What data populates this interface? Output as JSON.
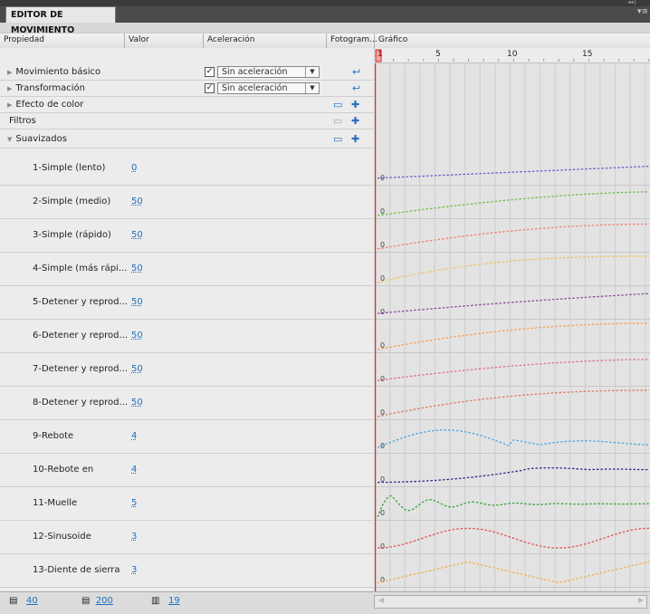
{
  "panel": {
    "tab_label": "EDITOR DE MOVIMIENTO"
  },
  "columns": {
    "property": "Propiedad",
    "value": "Valor",
    "ease": "Aceleración",
    "keyframe": "Fotogram...",
    "graph": "Gráfico"
  },
  "ruler": {
    "ticks": [
      "1",
      "5",
      "10",
      "15"
    ]
  },
  "sections": [
    {
      "label": "Movimiento básico",
      "ease_checked": true,
      "ease": "Sin aceleración"
    },
    {
      "label": "Transformación",
      "ease_checked": true,
      "ease": "Sin aceleración"
    },
    {
      "label": "Efecto de color"
    },
    {
      "label": "Filtros"
    },
    {
      "label": "Suavizados"
    }
  ],
  "eases": [
    {
      "label": "1-Simple (lento)",
      "value": "0",
      "color": "#6a5acd"
    },
    {
      "label": "2-Simple (medio)",
      "value": "50",
      "color": "#6abf4a"
    },
    {
      "label": "3-Simple (rápido)",
      "value": "50",
      "color": "#f08070"
    },
    {
      "label": "4-Simple (más rápi...",
      "value": "50",
      "color": "#f5c060"
    },
    {
      "label": "5-Detener y reprod...",
      "value": "50",
      "color": "#8a4a9a"
    },
    {
      "label": "6-Detener y reprod...",
      "value": "50",
      "color": "#f5a050"
    },
    {
      "label": "7-Detener y reprod...",
      "value": "50",
      "color": "#e0708a"
    },
    {
      "label": "8-Detener y reprod...",
      "value": "50",
      "color": "#e07a5a"
    },
    {
      "label": "9-Rebote",
      "value": "4",
      "color": "#4aa8e0"
    },
    {
      "label": "10-Rebote en",
      "value": "4",
      "color": "#2a2a8a"
    },
    {
      "label": "11-Muelle",
      "value": "5",
      "color": "#3aa03a"
    },
    {
      "label": "12-Sinusoide",
      "value": "3",
      "color": "#e05050"
    },
    {
      "label": "13-Diente de sierra",
      "value": "3",
      "color": "#f0b040"
    }
  ],
  "graph_zero_label": "0",
  "footer": {
    "view_a": "40",
    "view_b": "200",
    "frames": "19"
  }
}
